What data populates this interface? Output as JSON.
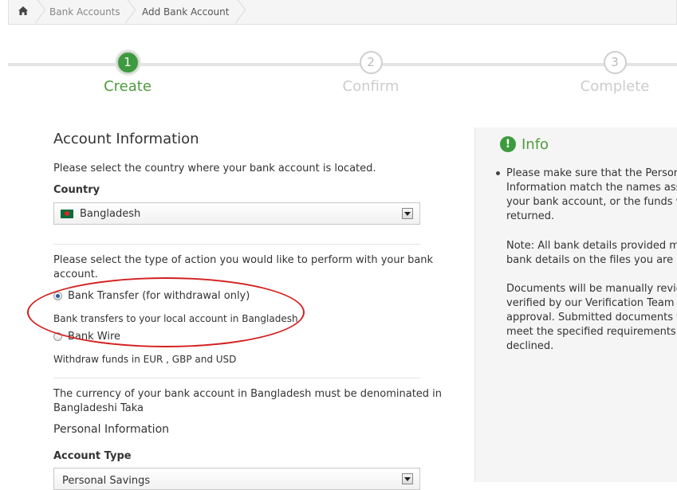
{
  "breadcrumb": {
    "home_icon": "home-icon",
    "items": [
      "Bank Accounts",
      "Add Bank Account"
    ]
  },
  "steps": [
    {
      "number": "1",
      "label": "Create"
    },
    {
      "number": "2",
      "label": "Confirm"
    },
    {
      "number": "3",
      "label": "Complete"
    }
  ],
  "account_info": {
    "title": "Account Information",
    "country_prompt": "Please select the country where your bank account is located.",
    "country_label": "Country",
    "country_value": "Bangladesh",
    "action_prompt_1": "Please select the type of action you would like to perform with your bank",
    "action_prompt_2": "account.",
    "options": [
      {
        "label": "Bank Transfer (for withdrawal only)",
        "desc": "Bank transfers to your local account in Bangladesh",
        "checked": true
      },
      {
        "label": "Bank Wire",
        "desc": "Withdraw funds in EUR , GBP and USD",
        "checked": false
      }
    ],
    "currency_note_1": "The currency of your bank account in Bangladesh must be denominated in",
    "currency_note_2": "Bangladeshi Taka"
  },
  "personal_info": {
    "title": "Personal Information",
    "account_type_label": "Account Type",
    "account_type_value": "Personal Savings"
  },
  "info": {
    "title": "Info",
    "icon": "exclamation-icon",
    "para1": "Please make sure that the Personal\nInformation match the names asso\nyour bank account, or the funds wil\nreturned.",
    "para2": "Note: All bank details provided mus\nbank details on the files you are upl",
    "para3": "Documents will be manually review\nverified by our Verification Team pri\napproval. Submitted documents tha\nmeet the specified requirements wi\ndeclined."
  },
  "colors": {
    "accent_green": "#3e9a3e",
    "annotation_red": "#d41f1f"
  }
}
